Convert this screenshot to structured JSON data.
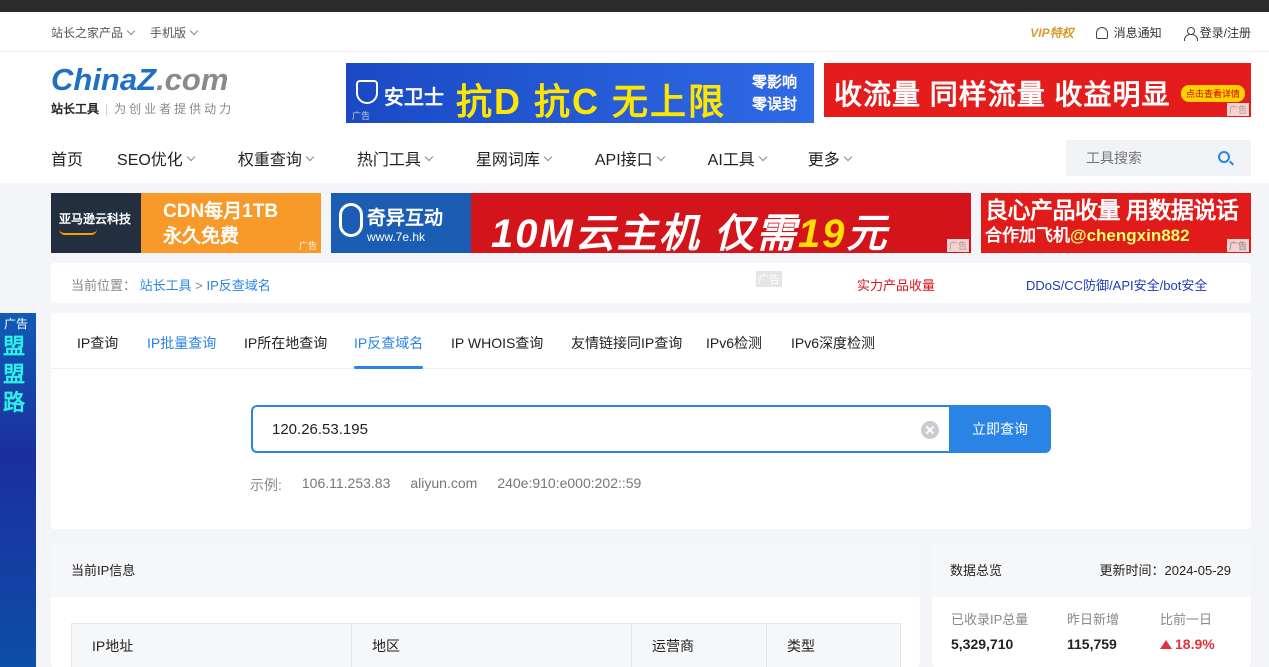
{
  "topnav": {
    "left": [
      "站长之家产品",
      "手机版"
    ],
    "vip": "VIP特权",
    "notify": "消息通知",
    "login": "登录/注册"
  },
  "logo": {
    "brand_a": "ChinaZ",
    "brand_b": ".com",
    "slogan_bold": "站长工具",
    "slogan_text": "为创业者提供动力"
  },
  "ads": {
    "anweishi": {
      "name": "安卫士",
      "headline": "抗D 抗C 无上限",
      "line1": "零影响",
      "line2": "零误封"
    },
    "flow": {
      "headline": "收流量 同样流量 收益明显",
      "button": "点击查看详情"
    },
    "amazon": {
      "left": "亚马逊云科技",
      "line1": "CDN每月1TB",
      "line2": "永久免费"
    },
    "qiyi": {
      "name": "奇异互动",
      "url": "www.7e.hk",
      "headline_a": "10M云主机 仅需",
      "headline_b": "19",
      "headline_c": "元"
    },
    "liangxin": {
      "line1": "良心产品收量 用数据说话",
      "line2_a": "合作加飞机",
      "line2_b": "@chengxin882"
    },
    "tag": "广告",
    "left_tag": "广告",
    "left_chars": "盟盟路"
  },
  "mainnav": [
    "首页",
    "SEO优化",
    "权重查询",
    "热门工具",
    "星网词库",
    "API接口",
    "AI工具",
    "更多"
  ],
  "search": {
    "placeholder": "工具搜索"
  },
  "breadcrumb": {
    "prefix": "当前位置：",
    "home": "站长工具",
    "sep": ">",
    "current": "IP反查域名",
    "ad_label": "广告",
    "link_red": "实力产品收量",
    "link_blue": "DDoS/CC防御/API安全/bot安全"
  },
  "tabs": [
    "IP查询",
    "IP批量查询",
    "IP所在地查询",
    "IP反查域名",
    "IP WHOIS查询",
    "友情链接同IP查询",
    "IPv6检测",
    "IPv6深度检测"
  ],
  "query": {
    "value": "120.26.53.195",
    "button": "立即查询",
    "examples_label": "示例:",
    "examples": [
      "106.11.253.83",
      "aliyun.com",
      "240e:910:e000:202::59"
    ]
  },
  "ipinfo": {
    "title": "当前IP信息",
    "columns": [
      "IP地址",
      "地区",
      "运营商",
      "类型"
    ]
  },
  "stats": {
    "title": "数据总览",
    "updated": "更新时间：2024-05-29",
    "items": [
      {
        "label": "已收录IP总量",
        "value": "5,329,710"
      },
      {
        "label": "昨日新增",
        "value": "115,759"
      },
      {
        "label": "比前一日",
        "value": "18.9%"
      }
    ]
  }
}
